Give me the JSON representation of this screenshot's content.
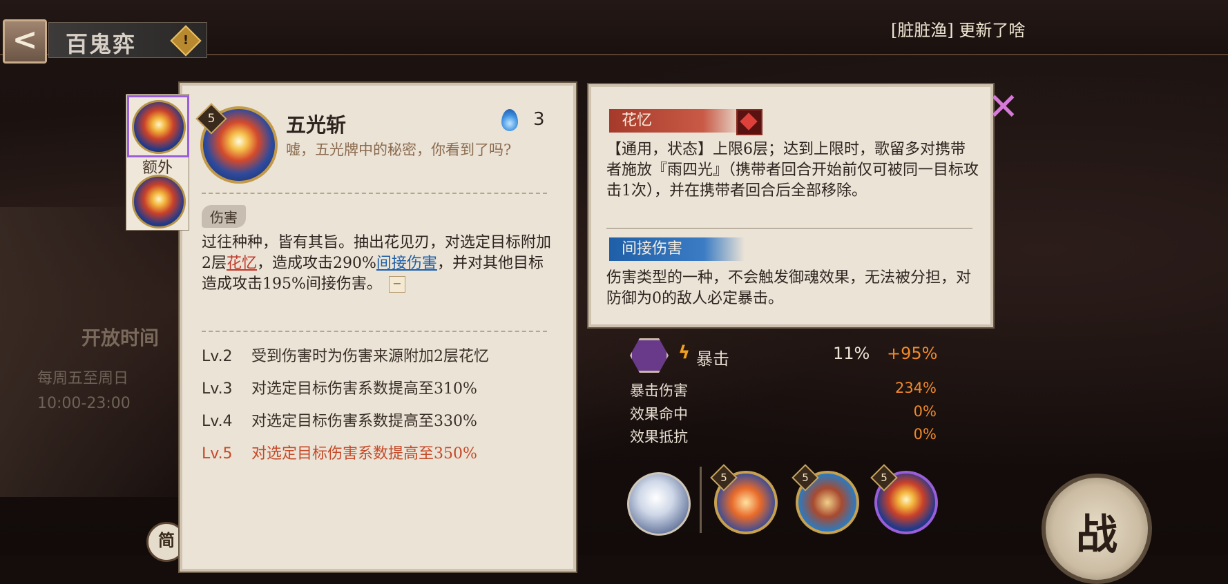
{
  "header": {
    "back_glyph": "<",
    "page_title": "百鬼弈",
    "warn_glyph": "!",
    "notice": "[脏脏渔] 更新了啥"
  },
  "left_panel": {
    "open_time_label": "开放时间",
    "open_days": "每周五至周日",
    "open_hours": "10:00-23:00",
    "simple_toggle": "简"
  },
  "skill_thumbs": {
    "extra_label": "额外"
  },
  "skill_card": {
    "level": "5",
    "name": "五光斩",
    "orb_cost": "3",
    "flavor": "嘘，五光牌中的秘密，你看到了吗?",
    "tag": "伤害",
    "desc_part1": "过往种种，皆有其旨。抽出花见刃，对选定目标附加2层",
    "desc_kw1": "花忆",
    "desc_part2": "，造成攻击290%",
    "desc_kw2": "间接伤害",
    "desc_part3": "，并对其他目标造成攻击195%间接伤害。",
    "collapse_glyph": "−",
    "levels": [
      {
        "lv": "Lv.2",
        "text": "受到伤害时为伤害来源附加2层花忆"
      },
      {
        "lv": "Lv.3",
        "text": "对选定目标伤害系数提高至310%"
      },
      {
        "lv": "Lv.4",
        "text": "对选定目标伤害系数提高至330%"
      },
      {
        "lv": "Lv.5",
        "text": "对选定目标伤害系数提高至350%"
      }
    ]
  },
  "info_popup": {
    "huayi_tag": "花忆",
    "huayi_desc": "【通用，状态】上限6层；达到上限时，歌留多对携带者施放『雨四光』（携带者回合开始前仅可被同一目标攻击1次），并在携带者回合后全部移除。",
    "indirect_tag": "间接伤害",
    "indirect_desc": "伤害类型的一种，不会触发御魂效果，无法被分担，对防御为0的敌人必定暴击。"
  },
  "stats": {
    "crit_label": "暴击",
    "crit_base": "11%",
    "crit_bonus": "+95%",
    "rows": [
      {
        "label": "暴击伤害",
        "value": "234%"
      },
      {
        "label": "效果命中",
        "value": "0%"
      },
      {
        "label": "效果抵抗",
        "value": "0%"
      }
    ]
  },
  "team": {
    "skill_levels": [
      "5",
      "5",
      "5"
    ],
    "battle_label": "战"
  },
  "colors": {
    "accent_red": "#c0392b",
    "accent_blue": "#1f5fa8",
    "bonus_orange": "#f28a2a"
  }
}
